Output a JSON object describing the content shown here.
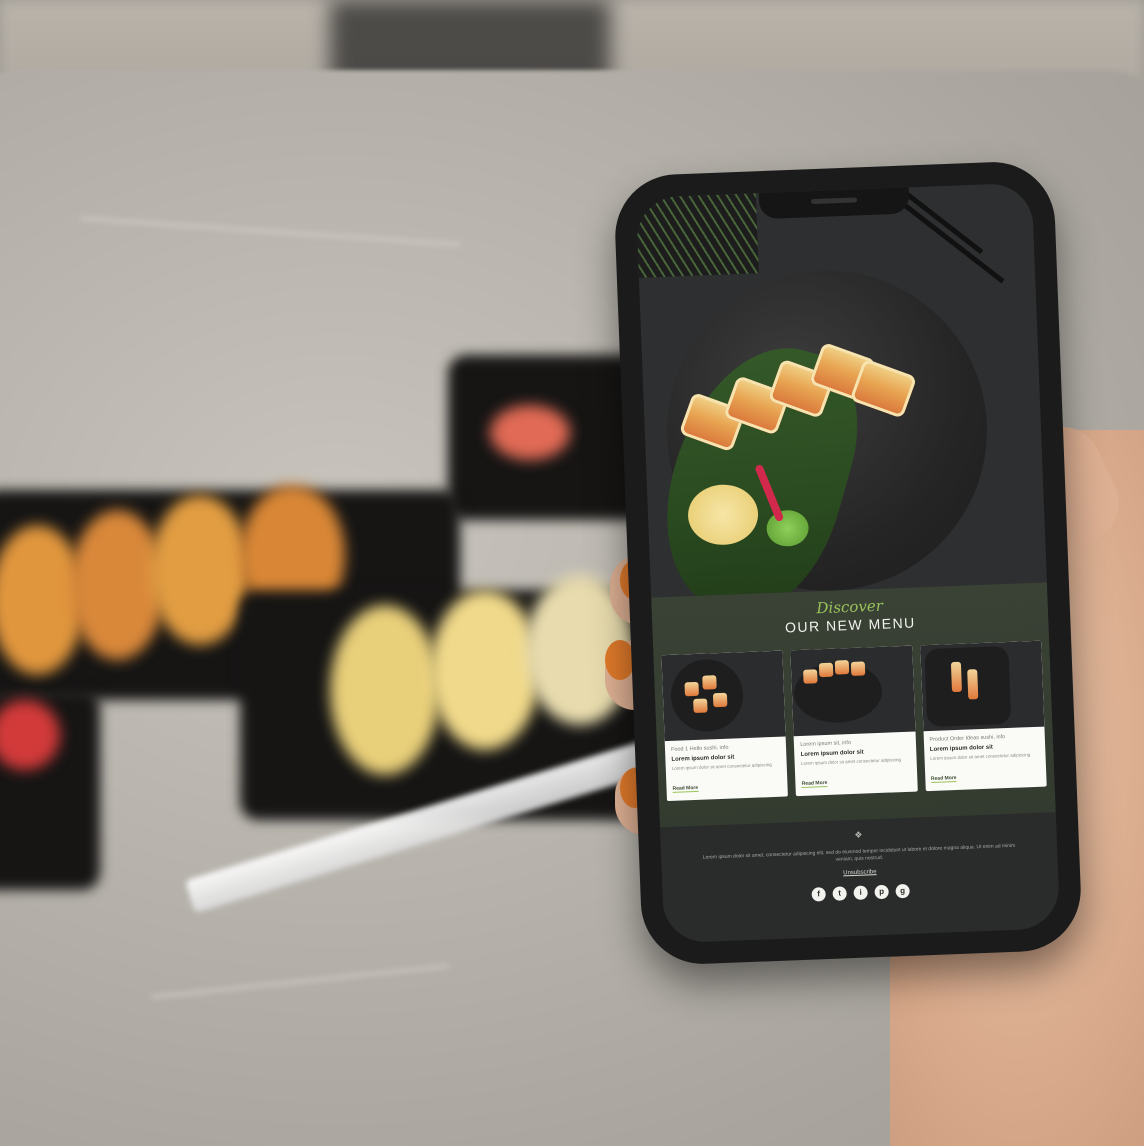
{
  "promo": {
    "kicker": "Discover",
    "title": "OUR NEW MENU"
  },
  "cards": [
    {
      "meta": "Food 1 Hello sushi, info",
      "heading": "Lorem ipsum dolor sit",
      "text": "Lorem ipsum dolor sit amet consectetur adipiscing",
      "link": "Read More"
    },
    {
      "meta": "Lorem ipsum sit, info",
      "heading": "Lorem ipsum dolor sit",
      "text": "Lorem ipsum dolor sit amet consectetur adipiscing",
      "link": "Read More"
    },
    {
      "meta": "Product Order Ideas sushi, info",
      "heading": "Lorem ipsum dolor sit",
      "text": "Lorem ipsum dolor sit amet consectetur adipiscing",
      "link": "Read More"
    }
  ],
  "footer": {
    "text": "Lorem ipsum dolor sit amet, consectetur adipiscing elit, sed do eiusmod tempor incididunt ut labore et dolore magna aliqua. Ut enim ad minim veniam, quis nostrud.",
    "link": "Unsubscribe",
    "socials": [
      "f",
      "t",
      "i",
      "p",
      "g"
    ]
  },
  "colors": {
    "accent": "#9ac45a",
    "promo_bg": "#3a4236",
    "footer_bg": "#2a2c2b"
  },
  "icons": [
    "logo-icon",
    "facebook-icon",
    "twitter-icon",
    "instagram-icon",
    "pinterest-icon",
    "google-plus-icon"
  ]
}
